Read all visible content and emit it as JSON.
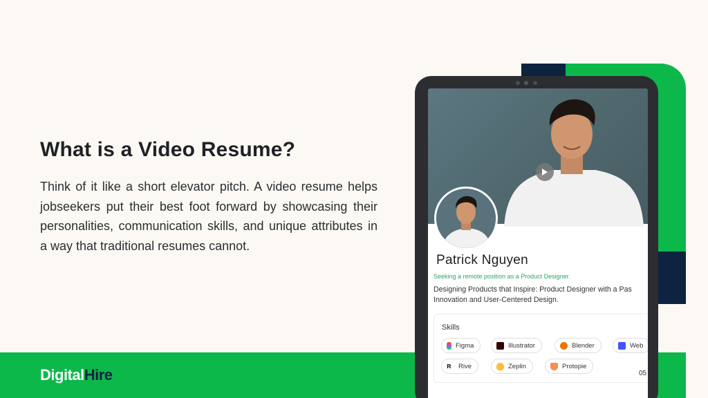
{
  "headline": "What is a Video Resume?",
  "body": "Think of it like a short elevator pitch. A video resume helps jobseekers put their best foot forward by showcasing their personalities, communication skills, and unique attributes in a way that traditional resumes cannot.",
  "logo": {
    "part1": "Digital",
    "part2": "Hire"
  },
  "profile": {
    "name": "Patrick Nguyen",
    "tagline": "Seeking a remote position as a Product Designer.",
    "description": "Designing Products that Inspire: Product Designer with a Pas Innovation and User-Centered Design."
  },
  "skills": {
    "title": "Skills",
    "items": [
      {
        "label": "Figma",
        "icon": "figma-icon"
      },
      {
        "label": "Illustrator",
        "icon": "illustrator-icon"
      },
      {
        "label": "Blender",
        "icon": "blender-icon"
      },
      {
        "label": "Web",
        "icon": "webflow-icon"
      },
      {
        "label": "Rive",
        "icon": "rive-icon"
      },
      {
        "label": "Zeplin",
        "icon": "zeplin-icon"
      },
      {
        "label": "Protopie",
        "icon": "protopie-icon"
      }
    ]
  },
  "timestamp": "05",
  "colors": {
    "brand_green": "#0cb84a",
    "navy": "#0d2340",
    "background": "#fcf9f4"
  }
}
